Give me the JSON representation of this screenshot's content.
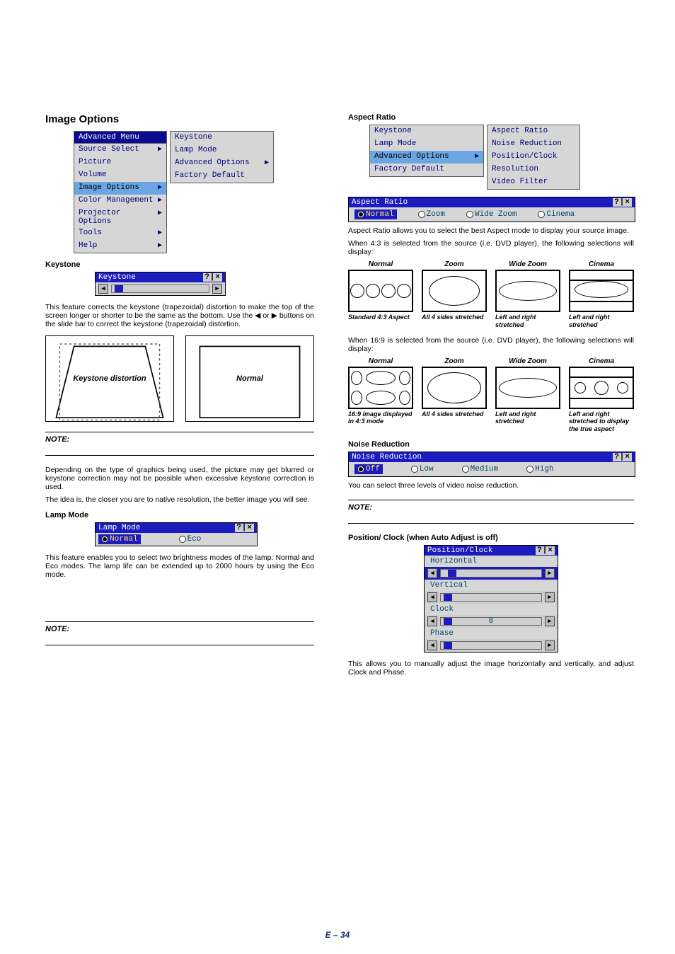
{
  "pageNumber": "E – 34",
  "left": {
    "heading": "Image Options",
    "advMenu": {
      "title": "Advanced Menu",
      "items": [
        {
          "label": "Source Select",
          "arrow": true
        },
        {
          "label": "Picture",
          "arrow": false
        },
        {
          "label": "Volume",
          "arrow": false
        },
        {
          "label": "Image Options",
          "arrow": true,
          "sel": true
        },
        {
          "label": "Color Management",
          "arrow": true
        },
        {
          "label": "Projector Options",
          "arrow": true
        },
        {
          "label": "Tools",
          "arrow": true
        },
        {
          "label": "Help",
          "arrow": true
        }
      ]
    },
    "subMenu": {
      "items": [
        {
          "label": "Keystone"
        },
        {
          "label": "Lamp Mode"
        },
        {
          "label": "Advanced Options",
          "arrow": true
        },
        {
          "label": "Factory Default"
        }
      ]
    },
    "keystoneHeading": "Keystone",
    "keystoneWin": {
      "title": "Keystone",
      "btns": "?|×"
    },
    "keystoneText": "This feature corrects the keystone (trapezoidal) distortion to make the top of the screen longer or shorter to be the same as the bottom. Use the ◀ or ▶ buttons on the slide bar to correct the keystone (trapezoidal) distortion.",
    "distortLabelLeft": "Keystone distortion",
    "distortLabelRight": "Normal",
    "note1": "NOTE:",
    "dependingText": "Depending on the type of graphics being used, the picture may get blurred or keystone correction may not be possible when excessive keystone correction is used.",
    "ideaText": "The idea is, the closer you are to native resolution, the better image you will see.",
    "lampHeading": "Lamp Mode",
    "lampWin": {
      "title": "Lamp Mode",
      "btns": "?|×",
      "opt1": "Normal",
      "opt2": "Eco"
    },
    "lampText": "This feature enables you to select two brightness modes of the lamp: Normal and Eco modes. The lamp life can be extended up to 2000 hours by using the Eco mode.",
    "note2": "NOTE:"
  },
  "right": {
    "aspectHeading": "Aspect Ratio",
    "leftMenu": {
      "items": [
        {
          "label": "Keystone"
        },
        {
          "label": "Lamp Mode"
        },
        {
          "label": "Advanced Options",
          "arrow": true,
          "sel": true
        },
        {
          "label": "Factory Default"
        }
      ]
    },
    "rightMenu": {
      "items": [
        {
          "label": "Aspect Ratio"
        },
        {
          "label": "Noise Reduction"
        },
        {
          "label": "Position/Clock"
        },
        {
          "label": "Resolution"
        },
        {
          "label": "Video Filter"
        }
      ]
    },
    "arWin": {
      "title": "Aspect Ratio",
      "btns": "?|×",
      "opts": [
        "Normal",
        "Zoom",
        "Wide Zoom",
        "Cinema"
      ]
    },
    "arText1": "Aspect Ratio allows you to select the best Aspect mode to display your source image.",
    "arText2": "When 4:3 is selected from the source (i.e. DVD player), the following selections will display:",
    "arRow43": {
      "labels": [
        "Normal",
        "Zoom",
        "Wide Zoom",
        "Cinema"
      ],
      "caps": [
        "Standard 4:3 Aspect",
        "All 4 sides stretched",
        "Left and right stretched",
        "Left and right stretched"
      ]
    },
    "arText3": "When 16:9 is selected from the source (i.e. DVD player), the following selections will display:",
    "arRow169": {
      "labels": [
        "Normal",
        "Zoom",
        "Wide Zoom",
        "Cinema"
      ],
      "caps": [
        "16:9 image displayed in 4:3 mode",
        "All 4 sides stretched",
        "Left and right stretched",
        "Left and right stretched to display the true aspect"
      ]
    },
    "nrHeading": "Noise Reduction",
    "nrWin": {
      "title": "Noise Reduction",
      "btns": "?|×",
      "opts": [
        "Off",
        "Low",
        "Medium",
        "High"
      ]
    },
    "nrText": "You can select three levels of video noise reduction.",
    "note3": "NOTE:",
    "pcHeading": "Position/ Clock (when Auto Adjust is off)",
    "pcWin": {
      "title": "Position/Clock",
      "btns": "?|×",
      "rows": [
        "Horizontal",
        "Vertical",
        "Clock",
        "Phase"
      ],
      "clockVal": "0"
    },
    "pcText": "This allows you to manually adjust the image horizontally and vertically, and adjust Clock and Phase."
  }
}
